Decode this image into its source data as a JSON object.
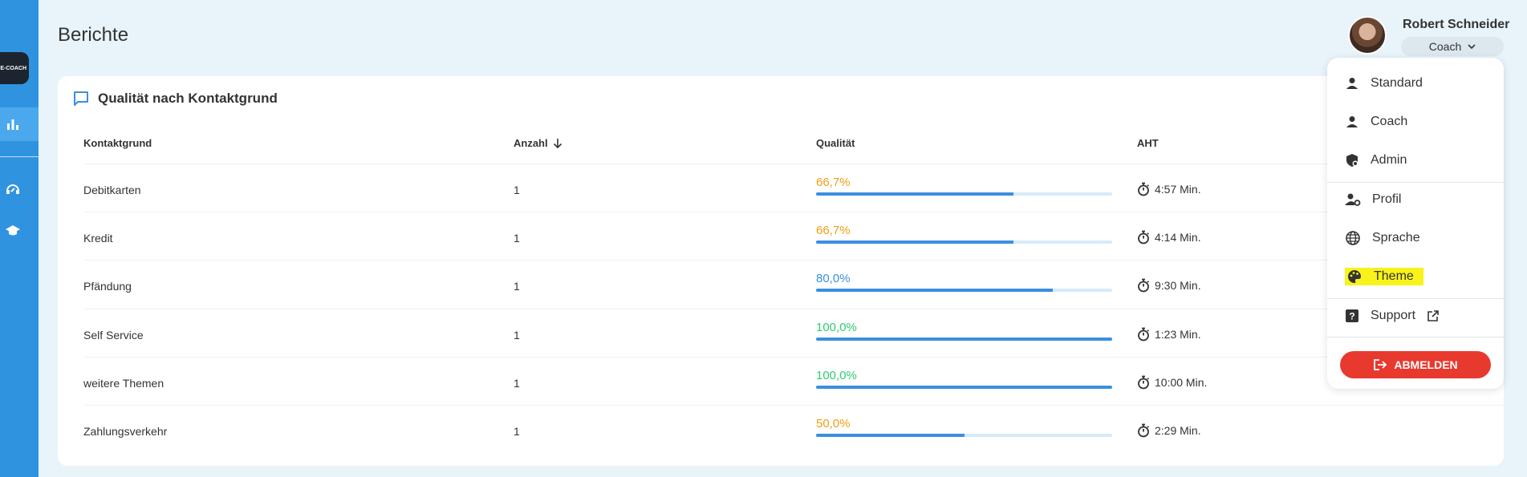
{
  "app": {
    "logo_text": "E-COACH"
  },
  "page": {
    "title": "Berichte"
  },
  "card": {
    "title": "Qualität nach Kontaktgrund",
    "columns": {
      "grund": "Kontaktgrund",
      "anzahl": "Anzahl",
      "qualitaet": "Qualität",
      "aht": "AHT"
    },
    "rows": [
      {
        "grund": "Debitkarten",
        "anzahl": "1",
        "qualitaet": "66,7%",
        "qualitaet_fraction": 0.667,
        "color": "#f39c12",
        "aht": "4:57 Min."
      },
      {
        "grund": "Kredit",
        "anzahl": "1",
        "qualitaet": "66,7%",
        "qualitaet_fraction": 0.667,
        "color": "#f39c12",
        "aht": "4:14 Min."
      },
      {
        "grund": "Pfändung",
        "anzahl": "1",
        "qualitaet": "80,0%",
        "qualitaet_fraction": 0.8,
        "color": "#3b8fe0",
        "aht": "9:30 Min."
      },
      {
        "grund": "Self Service",
        "anzahl": "1",
        "qualitaet": "100,0%",
        "qualitaet_fraction": 1.0,
        "color": "#2ecc71",
        "aht": "1:23 Min."
      },
      {
        "grund": "weitere Themen",
        "anzahl": "1",
        "qualitaet": "100,0%",
        "qualitaet_fraction": 1.0,
        "color": "#2ecc71",
        "aht": "10:00 Min."
      },
      {
        "grund": "Zahlungsverkehr",
        "anzahl": "1",
        "qualitaet": "50,0%",
        "qualitaet_fraction": 0.5,
        "color": "#f39c12",
        "aht": "2:29 Min."
      }
    ]
  },
  "user": {
    "name": "Robert Schneider",
    "role": "Coach"
  },
  "menu": {
    "standard": "Standard",
    "coach": "Coach",
    "admin": "Admin",
    "profil": "Profil",
    "sprache": "Sprache",
    "theme": "Theme",
    "support": "Support",
    "logout": "ABMELDEN"
  },
  "colors": {
    "sidebar": "#2f93e0",
    "accent": "#3b8fe0",
    "logout": "#e8392f",
    "highlight": "#f8f31a"
  }
}
